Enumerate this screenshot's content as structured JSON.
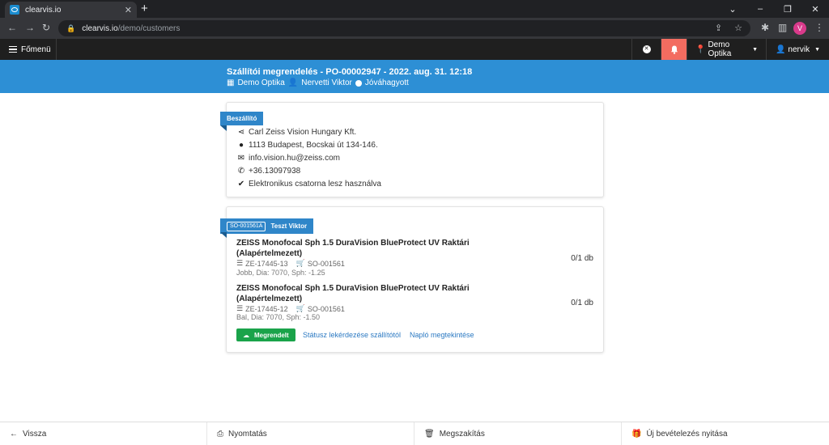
{
  "browser": {
    "tab_title": "clearvis.io",
    "url_host": "clearvis.io",
    "url_path": "/demo/customers",
    "profile_initial": "V"
  },
  "appnav": {
    "menu_label": "Főmenü",
    "location_label": "Demo Optika",
    "user_label": "nervik"
  },
  "header": {
    "title": "Szállítói megrendelés - PO-00002947 - 2022. aug. 31. 12:18",
    "shop": "Demo Optika",
    "person": "Nervetti Viktor",
    "status": "Jóváhagyott"
  },
  "supplier": {
    "ribbon": "Beszállító",
    "name": "Carl Zeiss Vision Hungary Kft.",
    "address": "1113 Budapest, Bocskai út 134-146.",
    "email": "info.vision.hu@zeiss.com",
    "phone": "+36.13097938",
    "channel": "Elektronikus csatorna lesz használva"
  },
  "order": {
    "badge": "SO-001561A",
    "customer": "Teszt Viktor",
    "items": [
      {
        "title": "ZEISS Monofocal Sph 1.5 DuraVision BlueProtect UV Raktári (Alapértelmezett)",
        "code": "ZE-17445-13",
        "so": "SO-001561",
        "detail": "Jobb, Dia: 7070, Sph: -1.25",
        "qty": "0/1 db"
      },
      {
        "title": "ZEISS Monofocal Sph 1.5 DuraVision BlueProtect UV Raktári (Alapértelmezett)",
        "code": "ZE-17445-12",
        "so": "SO-001561",
        "detail": "Bal, Dia: 7070, Sph: -1.50",
        "qty": "0/1 db"
      }
    ],
    "status_button": "Megrendelt",
    "link_status": "Státusz lekérdezése szállítótól",
    "link_log": "Napló megtekintése"
  },
  "footer": {
    "back": "Vissza",
    "print": "Nyomtatás",
    "cancel": "Megszakítás",
    "new_receipt": "Új bevételezés nyitása"
  },
  "colors": {
    "accent": "#2d8fd5",
    "ribbon": "#2f86c9",
    "bell": "#f36c60",
    "ok": "#1aa34a",
    "link": "#2b79c2"
  }
}
